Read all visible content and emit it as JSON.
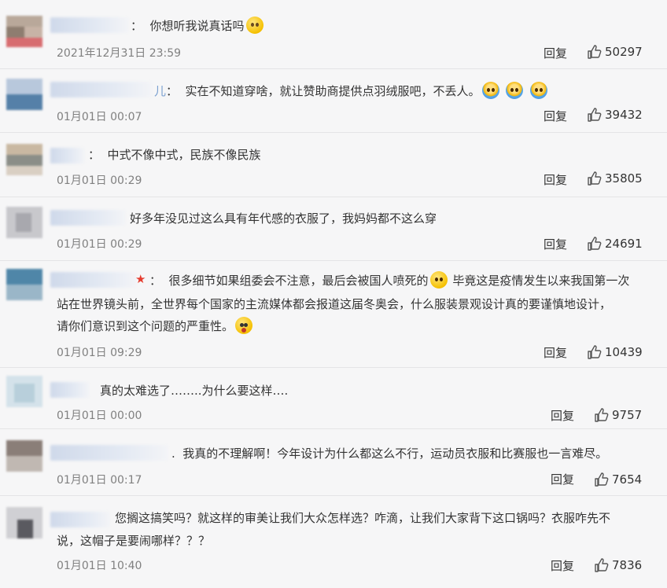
{
  "comments": [
    {
      "text": "：  你想听我说真话吗",
      "emoji": "sad",
      "time": "2021年12月31日 23:59",
      "reply": "回复",
      "likes": "50297"
    },
    {
      "prefix": "儿",
      "text": "：  实在不知道穿啥，就让赞助商提供点羽绒服吧，不丢人。",
      "emoji": "hug x3",
      "time": "01月01日 00:07",
      "reply": "回复",
      "likes": "39432"
    },
    {
      "text": "：  中式不像中式，民族不像民族",
      "time": "01月01日 00:29",
      "reply": "回复",
      "likes": "35805"
    },
    {
      "text": "好多年没见过这么具有年代感的衣服了，我妈妈都不这么穿",
      "time": "01月01日 00:29",
      "reply": "回复",
      "likes": "24691"
    },
    {
      "line1_a": "：  很多细节如果组委会不注意，最后会被国人喷死的",
      "line1_b": "毕竟这是疫情发生以来我国第一次",
      "line2": "站在世界镜头前，全世界每个国家的主流媒体都会报道这届冬奥会，什么服装景观设计真的要谨慎地设计，",
      "line3": "请你们意识到这个问题的严重性。",
      "time": "01月01日 09:29",
      "reply": "回复",
      "likes": "10439"
    },
    {
      "text": "真的太难选了……..为什么要这样….",
      "time": "01月01日 00:00",
      "reply": "回复",
      "likes": "9757"
    },
    {
      "text": ".  我真的不理解啊！今年设计为什么都这么不行，运动员衣服和比赛服也一言难尽。",
      "time": "01月01日 00:17",
      "reply": "回复",
      "likes": "7654"
    },
    {
      "line1": "您搁这搞笑吗？就这样的审美让我们大众怎样选？咋滴，让我们大家背下这口锅吗？衣服咋先不",
      "line2": "说，这帽子是要闹哪样？？？",
      "time": "01月01日 10:40",
      "reply": "回复",
      "likes": "7836"
    }
  ],
  "icons": {
    "like": "thumbs-up-icon"
  }
}
